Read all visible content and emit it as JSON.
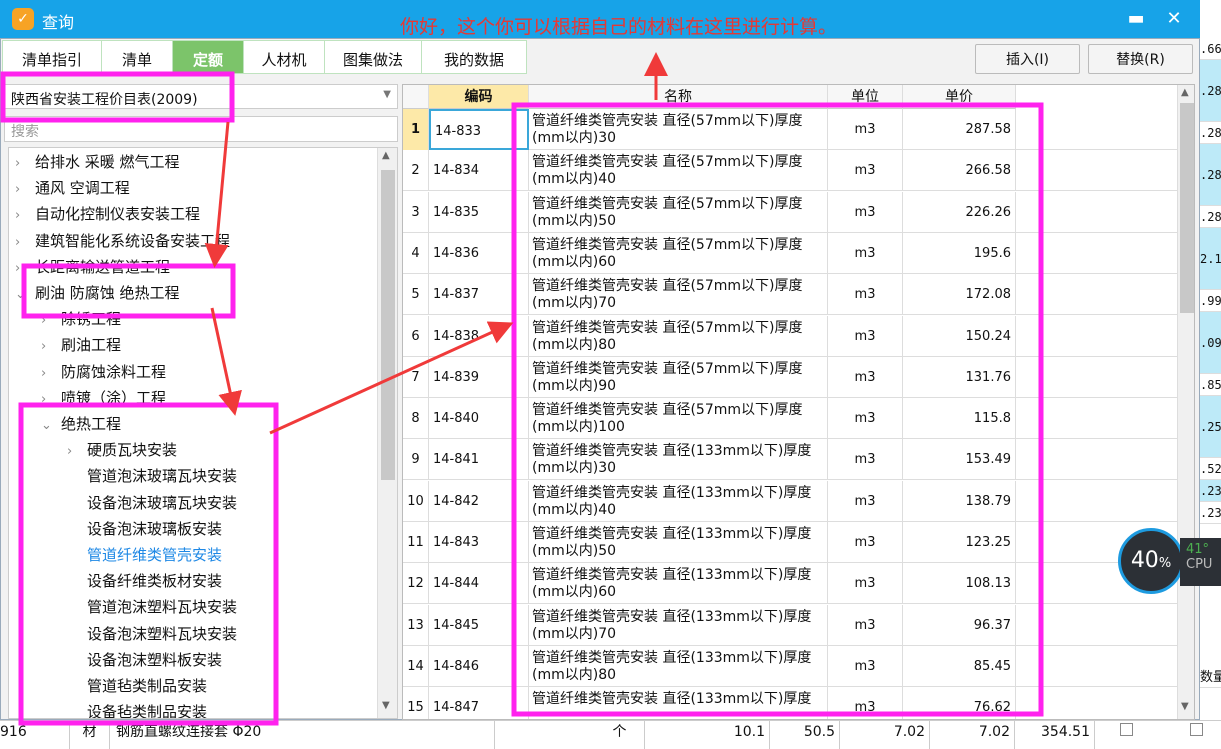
{
  "window": {
    "title": "查询",
    "minimize_icon": "minimize-icon",
    "close_icon": "close-icon"
  },
  "annotation": {
    "note": "你好，这个你可以根据自己的材料在这里进行计算。",
    "box_color": "#ff22ee",
    "arrow_color": "#f03a3a"
  },
  "tabs": [
    {
      "label": "清单指引"
    },
    {
      "label": "清单"
    },
    {
      "label": "定额",
      "active": true
    },
    {
      "label": "人材机"
    },
    {
      "label": "图集做法"
    },
    {
      "label": "我的数据"
    }
  ],
  "toolbar": {
    "insert": "插入(I)",
    "replace": "替换(R)"
  },
  "library": {
    "selected": "陕西省安装工程价目表(2009)",
    "search_placeholder": "搜索"
  },
  "tree": [
    {
      "label": "给排水 采暖 燃气工程",
      "level": 0,
      "expanded": false
    },
    {
      "label": "通风 空调工程",
      "level": 0,
      "expanded": false
    },
    {
      "label": "自动化控制仪表安装工程",
      "level": 0,
      "expanded": false
    },
    {
      "label": "建筑智能化系统设备安装工程",
      "level": 0,
      "expanded": false
    },
    {
      "label": "长距离输送管道工程",
      "level": 0,
      "expanded": false
    },
    {
      "label": "刷油 防腐蚀 绝热工程",
      "level": 0,
      "expanded": true
    },
    {
      "label": "除锈工程",
      "level": 1,
      "expanded": false
    },
    {
      "label": "刷油工程",
      "level": 1,
      "expanded": false
    },
    {
      "label": "防腐蚀涂料工程",
      "level": 1,
      "expanded": false
    },
    {
      "label": "喷镀（涂）工程",
      "level": 1,
      "expanded": false
    },
    {
      "label": "绝热工程",
      "level": 1,
      "expanded": true
    },
    {
      "label": "硬质瓦块安装",
      "level": 2,
      "expanded": false
    },
    {
      "label": "管道泡沫玻璃瓦块安装",
      "level": 2
    },
    {
      "label": "设备泡沫玻璃瓦块安装",
      "level": 2
    },
    {
      "label": "设备泡沫玻璃板安装",
      "level": 2
    },
    {
      "label": "管道纤维类管壳安装",
      "level": 2,
      "selected": true
    },
    {
      "label": "设备纤维类板材安装",
      "level": 2
    },
    {
      "label": "管道泡沫塑料瓦块安装",
      "level": 2
    },
    {
      "label": "设备泡沫塑料瓦块安装",
      "level": 2
    },
    {
      "label": "设备泡沫塑料板安装",
      "level": 2
    },
    {
      "label": "管道毡类制品安装",
      "level": 2
    },
    {
      "label": "设备毡类制品安装",
      "level": 2
    }
  ],
  "grid": {
    "headers": {
      "code": "编码",
      "name": "名称",
      "unit": "单位",
      "price": "单价"
    },
    "rows": [
      {
        "n": "1",
        "code": "14-833",
        "name1": "管道纤维类管壳安装 直径(57mm以下)厚度",
        "name2": "(mm以内)30",
        "unit": "m3",
        "price": "287.58"
      },
      {
        "n": "2",
        "code": "14-834",
        "name1": "管道纤维类管壳安装 直径(57mm以下)厚度",
        "name2": "(mm以内)40",
        "unit": "m3",
        "price": "266.58"
      },
      {
        "n": "3",
        "code": "14-835",
        "name1": "管道纤维类管壳安装 直径(57mm以下)厚度",
        "name2": "(mm以内)50",
        "unit": "m3",
        "price": "226.26"
      },
      {
        "n": "4",
        "code": "14-836",
        "name1": "管道纤维类管壳安装 直径(57mm以下)厚度",
        "name2": "(mm以内)60",
        "unit": "m3",
        "price": "195.6"
      },
      {
        "n": "5",
        "code": "14-837",
        "name1": "管道纤维类管壳安装 直径(57mm以下)厚度",
        "name2": "(mm以内)70",
        "unit": "m3",
        "price": "172.08"
      },
      {
        "n": "6",
        "code": "14-838",
        "name1": "管道纤维类管壳安装 直径(57mm以下)厚度",
        "name2": "(mm以内)80",
        "unit": "m3",
        "price": "150.24"
      },
      {
        "n": "7",
        "code": "14-839",
        "name1": "管道纤维类管壳安装 直径(57mm以下)厚度",
        "name2": "(mm以内)90",
        "unit": "m3",
        "price": "131.76"
      },
      {
        "n": "8",
        "code": "14-840",
        "name1": "管道纤维类管壳安装 直径(57mm以下)厚度",
        "name2": "(mm以内)100",
        "unit": "m3",
        "price": "115.8"
      },
      {
        "n": "9",
        "code": "14-841",
        "name1": "管道纤维类管壳安装 直径(133mm以下)厚度",
        "name2": "(mm以内)30",
        "unit": "m3",
        "price": "153.49"
      },
      {
        "n": "10",
        "code": "14-842",
        "name1": "管道纤维类管壳安装 直径(133mm以下)厚度",
        "name2": "(mm以内)40",
        "unit": "m3",
        "price": "138.79"
      },
      {
        "n": "11",
        "code": "14-843",
        "name1": "管道纤维类管壳安装 直径(133mm以下)厚度",
        "name2": "(mm以内)50",
        "unit": "m3",
        "price": "123.25"
      },
      {
        "n": "12",
        "code": "14-844",
        "name1": "管道纤维类管壳安装 直径(133mm以下)厚度",
        "name2": "(mm以内)60",
        "unit": "m3",
        "price": "108.13"
      },
      {
        "n": "13",
        "code": "14-845",
        "name1": "管道纤维类管壳安装 直径(133mm以下)厚度",
        "name2": "(mm以内)70",
        "unit": "m3",
        "price": "96.37"
      },
      {
        "n": "14",
        "code": "14-846",
        "name1": "管道纤维类管壳安装 直径(133mm以下)厚度",
        "name2": "(mm以内)80",
        "unit": "m3",
        "price": "85.45"
      },
      {
        "n": "15",
        "code": "14-847",
        "name1": "管道纤维类管壳安装 直径(133mm以下)厚度",
        "name2": "",
        "unit": "m3",
        "price": "76.62"
      }
    ]
  },
  "background": {
    "right_values": [
      ".66",
      ".28",
      ".28",
      ".28",
      ".28",
      "2.1",
      ".99",
      ".09",
      ".85",
      ".25",
      ".52",
      ".23",
      ".23"
    ],
    "qty_header": "数量",
    "bottom_row": {
      "code": "916",
      "type": "材",
      "name": "钢筋直螺纹连接套 Φ20",
      "unit": "个",
      "v1": "10.1",
      "v2": "50.5",
      "v3": "7.02",
      "v4": "7.02",
      "v5": "354.51"
    }
  },
  "cpu": {
    "usage": "40",
    "usage_unit": "%",
    "temp": "41°",
    "label": "CPU"
  }
}
